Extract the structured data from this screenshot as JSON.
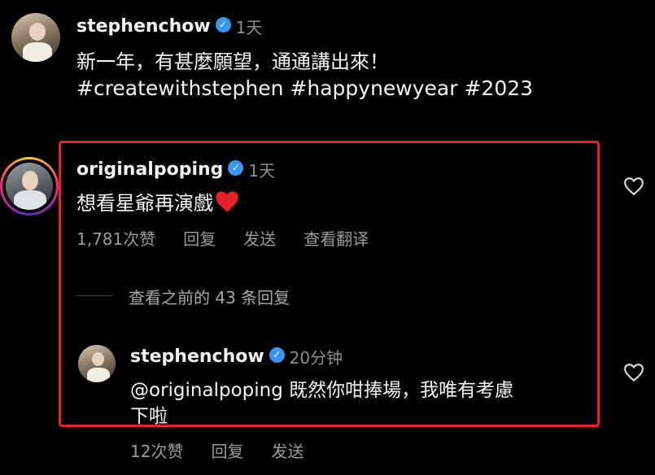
{
  "post": {
    "username": "stephenchow",
    "time": "1天",
    "line1": "新一年，有甚麼願望，通通講出來！",
    "line2": "#createwithstephen #happynewyear #2023"
  },
  "comment": {
    "username": "originalpoping",
    "time": "1天",
    "text": "想看星爺再演戲",
    "likes": "1,781次赞",
    "reply_label": "回复",
    "send_label": "发送",
    "translate_label": "查看翻译"
  },
  "view_replies": "查看之前的 43 条回复",
  "reply": {
    "username": "stephenchow",
    "time": "20分钟",
    "text_line1": "@originalpoping 既然你咁捧場，我唯有考慮",
    "text_line2": "下啦",
    "likes": "12次赞",
    "reply_label": "回复",
    "send_label": "发送"
  },
  "colors": {
    "verified": "#3897f0",
    "highlight": "#e8202a",
    "heart": "#e8202a"
  }
}
